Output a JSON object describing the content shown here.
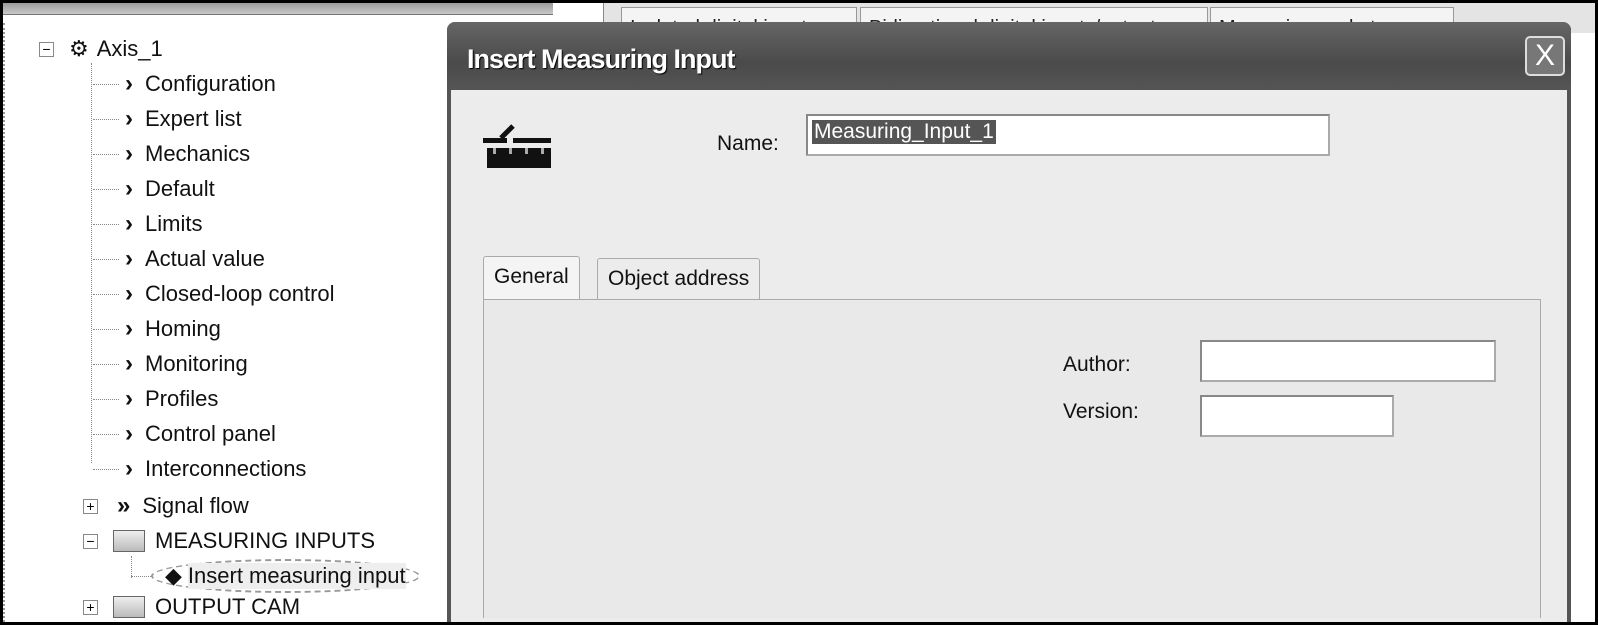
{
  "tree": {
    "root": "Axis_1",
    "items": [
      "Configuration",
      "Expert list",
      "Mechanics",
      "Default",
      "Limits",
      "Actual value",
      "Closed-loop control",
      "Homing",
      "Monitoring",
      "Profiles",
      "Control panel",
      "Interconnections"
    ],
    "signal_flow": "Signal flow",
    "measuring_inputs": "MEASURING INPUTS",
    "insert_measuring_input": "Insert measuring input",
    "output_cam": "OUTPUT CAM"
  },
  "background_tabs": [
    "Isolated digital inputs",
    "Bidirectional digital inputs/outputs",
    "Measuring sockets"
  ],
  "dialog": {
    "title": "Insert Measuring Input",
    "close": "X",
    "name_label": "Name:",
    "name_value": "Measuring_Input_1",
    "tabs": [
      "General",
      "Object address"
    ],
    "author_label": "Author:",
    "author_value": "",
    "version_label": "Version:",
    "version_value": ""
  }
}
